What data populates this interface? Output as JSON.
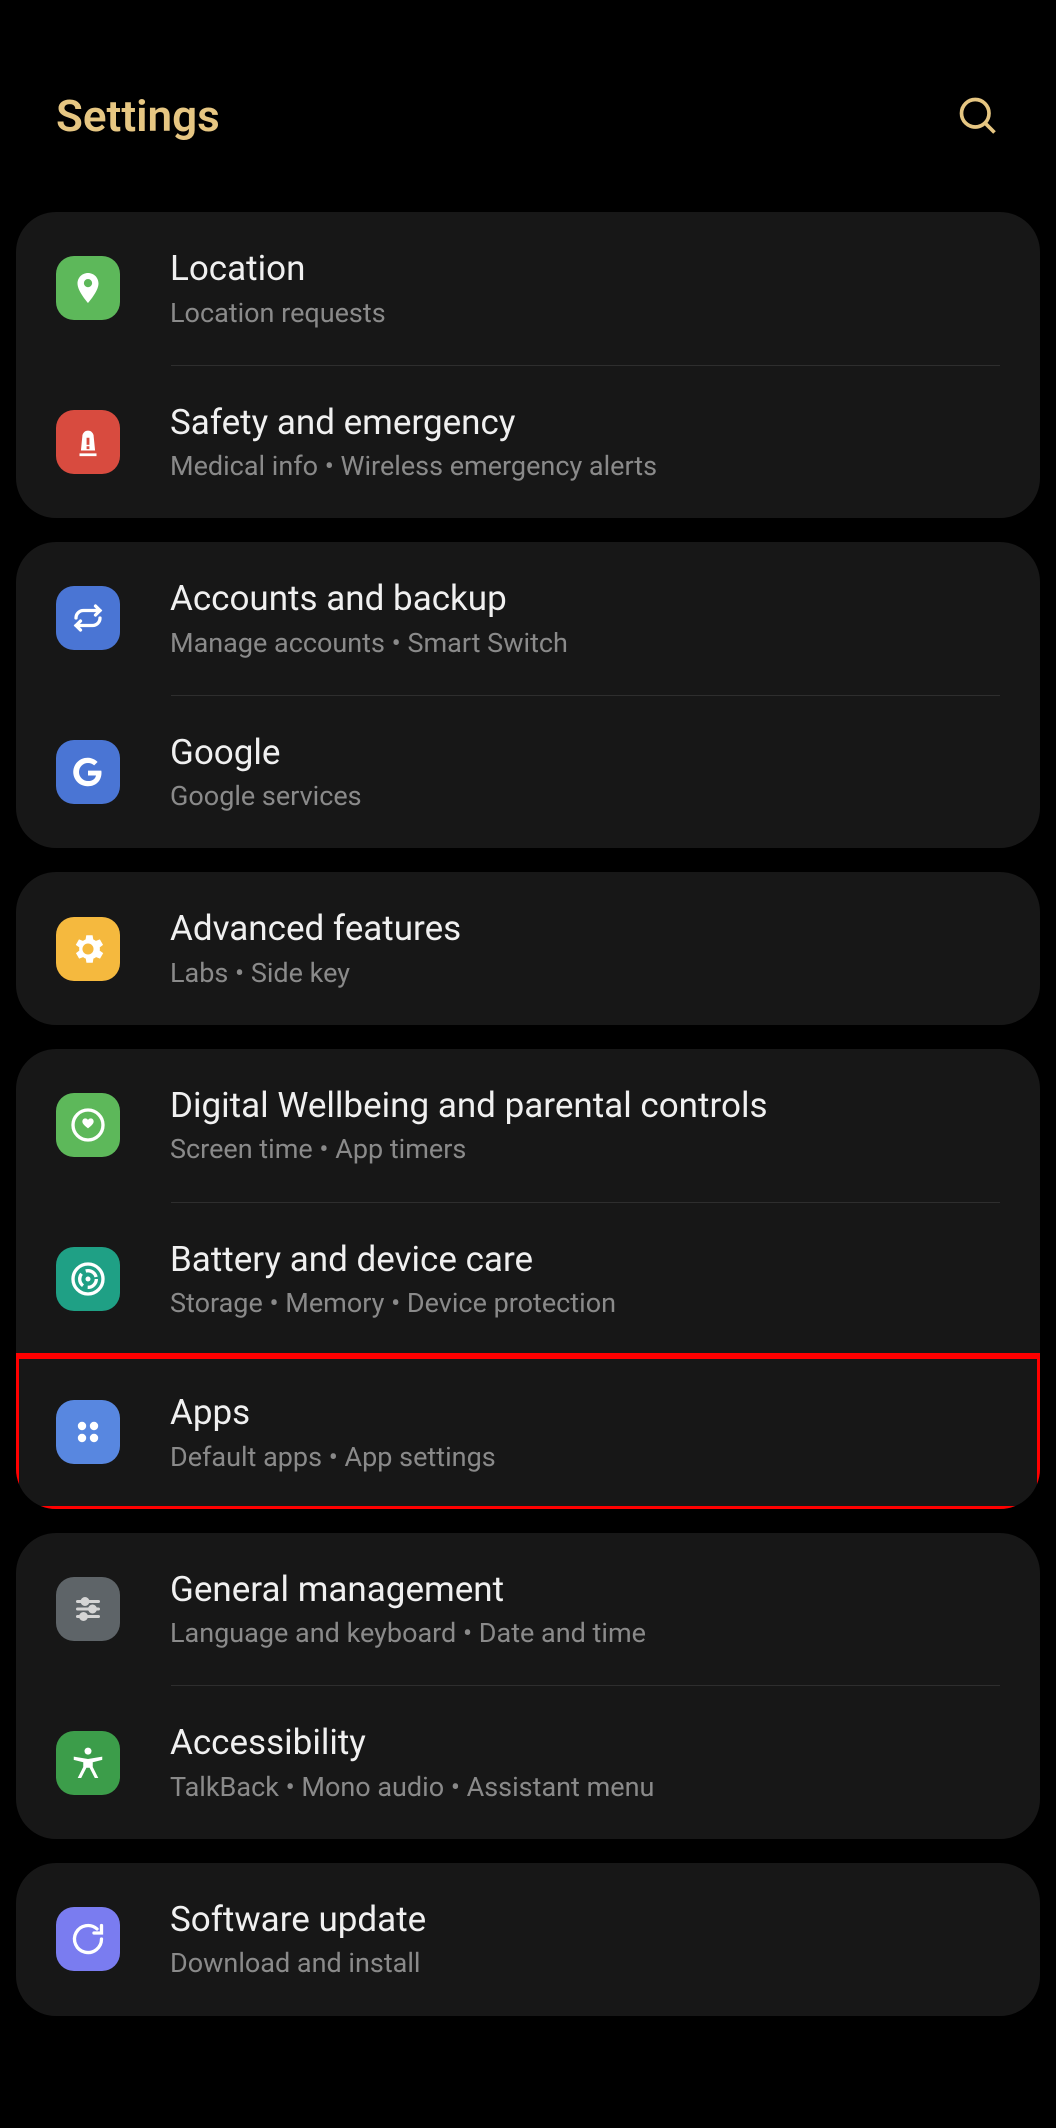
{
  "header": {
    "title": "Settings"
  },
  "groups": [
    {
      "items": [
        {
          "id": "location",
          "title": "Location",
          "subtitle": "Location requests",
          "iconClass": "icon-green",
          "icon": "location"
        },
        {
          "id": "safety",
          "title": "Safety and emergency",
          "subtitle": "Medical info  •  Wireless emergency alerts",
          "iconClass": "icon-red",
          "icon": "emergency"
        }
      ]
    },
    {
      "items": [
        {
          "id": "accounts",
          "title": "Accounts and backup",
          "subtitle": "Manage accounts  •  Smart Switch",
          "iconClass": "icon-blue",
          "icon": "sync"
        },
        {
          "id": "google",
          "title": "Google",
          "subtitle": "Google services",
          "iconClass": "icon-blue",
          "icon": "google"
        }
      ]
    },
    {
      "items": [
        {
          "id": "advanced",
          "title": "Advanced features",
          "subtitle": "Labs  •  Side key",
          "iconClass": "icon-yellow",
          "icon": "gear"
        }
      ]
    },
    {
      "items": [
        {
          "id": "wellbeing",
          "title": "Digital Wellbeing and parental controls",
          "subtitle": "Screen time  •  App timers",
          "iconClass": "icon-green2",
          "icon": "wellbeing"
        },
        {
          "id": "battery",
          "title": "Battery and device care",
          "subtitle": "Storage  •  Memory  •  Device protection",
          "iconClass": "icon-teal",
          "icon": "battery"
        },
        {
          "id": "apps",
          "title": "Apps",
          "subtitle": "Default apps  •  App settings",
          "iconClass": "icon-blue2",
          "icon": "apps",
          "highlighted": true
        }
      ]
    },
    {
      "items": [
        {
          "id": "general",
          "title": "General management",
          "subtitle": "Language and keyboard  •  Date and time",
          "iconClass": "icon-gray",
          "icon": "sliders"
        },
        {
          "id": "accessibility",
          "title": "Accessibility",
          "subtitle": "TalkBack  •  Mono audio  •  Assistant menu",
          "iconClass": "icon-green3",
          "icon": "accessibility"
        }
      ]
    },
    {
      "items": [
        {
          "id": "software",
          "title": "Software update",
          "subtitle": "Download and install",
          "iconClass": "icon-purple",
          "icon": "update"
        }
      ]
    }
  ]
}
